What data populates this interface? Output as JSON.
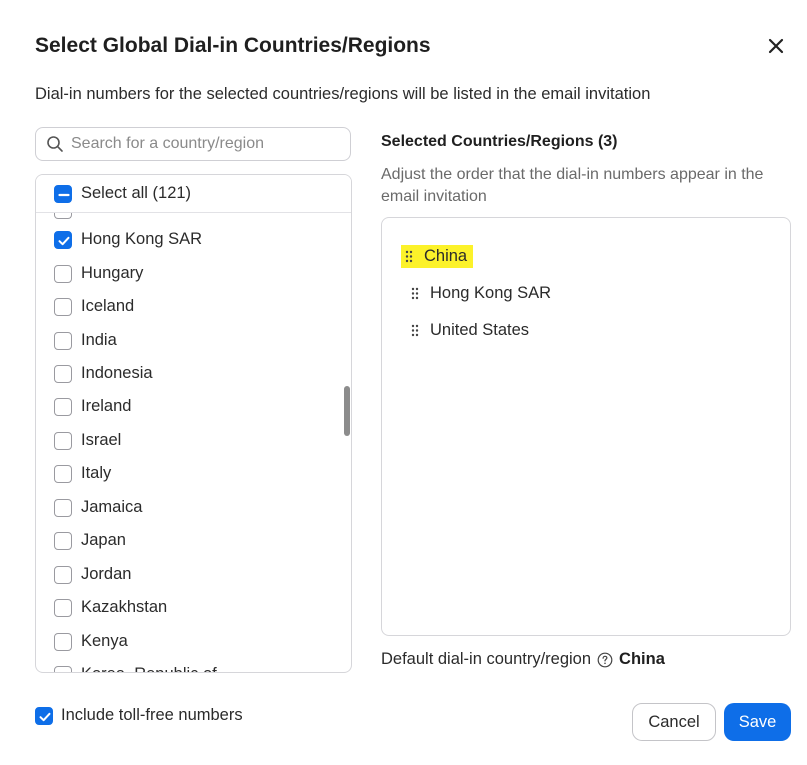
{
  "dialog": {
    "title": "Select Global Dial-in Countries/Regions",
    "description": "Dial-in numbers for the selected countries/regions will be listed in the email invitation"
  },
  "search": {
    "placeholder": "Search for a country/region",
    "value": ""
  },
  "country_list": {
    "select_all_label": "Select all (121)",
    "select_all_state": "indeterminate",
    "items": [
      {
        "label": "Hong Kong SAR",
        "checked": true
      },
      {
        "label": "Hungary",
        "checked": false
      },
      {
        "label": "Iceland",
        "checked": false
      },
      {
        "label": "India",
        "checked": false
      },
      {
        "label": "Indonesia",
        "checked": false
      },
      {
        "label": "Ireland",
        "checked": false
      },
      {
        "label": "Israel",
        "checked": false
      },
      {
        "label": "Italy",
        "checked": false
      },
      {
        "label": "Jamaica",
        "checked": false
      },
      {
        "label": "Japan",
        "checked": false
      },
      {
        "label": "Jordan",
        "checked": false
      },
      {
        "label": "Kazakhstan",
        "checked": false
      },
      {
        "label": "Kenya",
        "checked": false
      },
      {
        "label": "Korea, Republic of",
        "checked": false
      }
    ]
  },
  "selected": {
    "heading": "Selected Countries/Regions (3)",
    "hint": "Adjust the order that the dial-in numbers appear in the email invitation",
    "items": [
      {
        "label": "China",
        "highlighted": true
      },
      {
        "label": "Hong Kong SAR",
        "highlighted": false
      },
      {
        "label": "United States",
        "highlighted": false
      }
    ],
    "highlight_color": "#fcf22a"
  },
  "default_country": {
    "label": "Default dial-in country/region",
    "value": "China",
    "help_icon": "question-circle-icon"
  },
  "toll_free": {
    "label": "Include toll-free numbers",
    "checked": true
  },
  "buttons": {
    "cancel": "Cancel",
    "save": "Save"
  },
  "colors": {
    "accent": "#0e6ee8",
    "text": "#2b2b2b",
    "border": "#d6d6da"
  }
}
